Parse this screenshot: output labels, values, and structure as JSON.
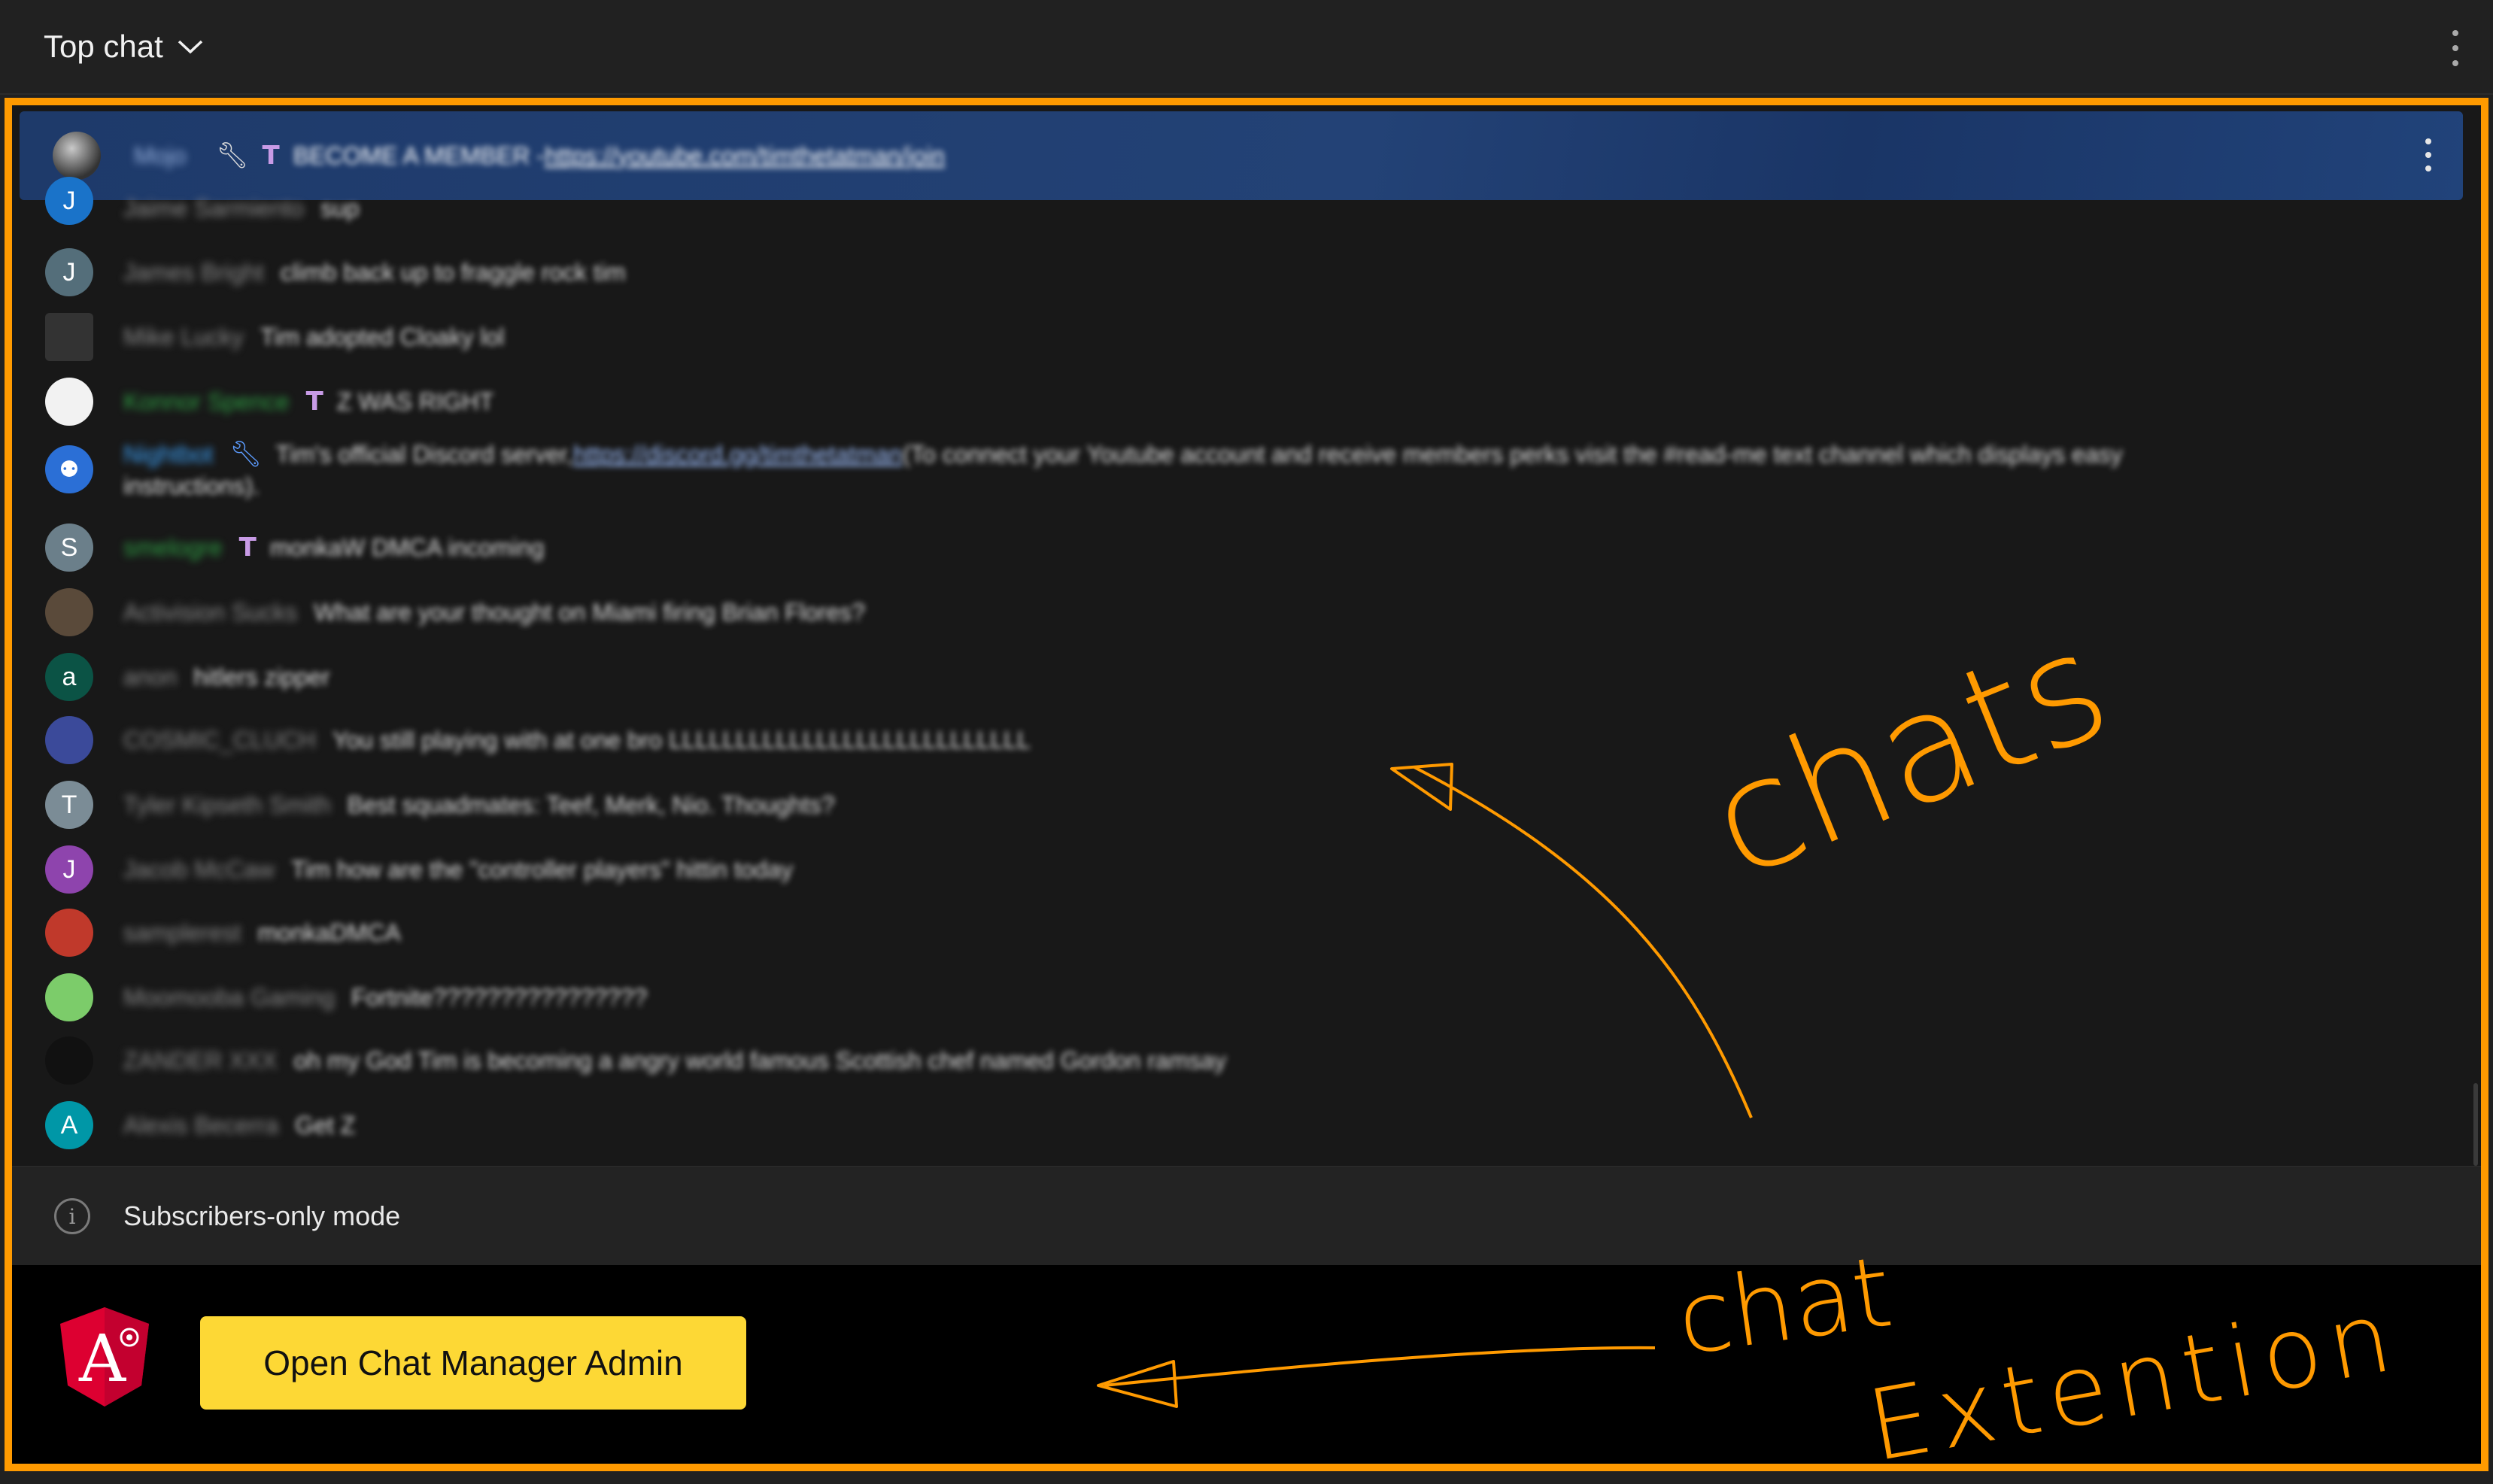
{
  "header": {
    "title": "Top chat",
    "dropdown_icon": "chevron-down-icon",
    "menu_icon": "more-vert-icon"
  },
  "pinned": {
    "author": "Mojo",
    "message": "BECOME A MEMBER - ",
    "link": "https://youtube.com/timthetatman/join"
  },
  "messages": [
    {
      "author": "Jaime Sarmiento",
      "avatar": "J",
      "color": "#1a73c9",
      "message": "sup"
    },
    {
      "author": "James Bright",
      "avatar": "J",
      "color": "#546e7a",
      "message": "climb back up to fraggle rock tim"
    },
    {
      "author": "Mike Lucky",
      "avatar": "",
      "color": "#333333",
      "message": "Tim adopted Cloaky lol"
    },
    {
      "author": "Konnor Spence",
      "avatar": "",
      "color": "#f2f2f2",
      "message": "Z WAS RIGHT"
    },
    {
      "author": "Nightbot",
      "avatar": "",
      "color": "#2b6fd6",
      "message": "Tim's official Discord server, ",
      "link": "https://discord.gg/timthetatman",
      "message2": " (To connect your Youtube account and receive members perks visit the #read-me text channel which displays easy",
      "message3": "instructions)."
    },
    {
      "author": "smelogre",
      "avatar": "S",
      "color": "#6b7f8a",
      "message": "monkaW DMCA incoming"
    },
    {
      "author": "Activision Sucks",
      "avatar": "",
      "color": "#5a4a3a",
      "message": "What are your thought on Miami firing Brian Flores?"
    },
    {
      "author": "anon",
      "avatar": "a",
      "color": "#0b5345",
      "message": "hitlers zipper"
    },
    {
      "author": "COSMIC_CLUCH",
      "avatar": "",
      "color": "#3b4a9a",
      "message": "You still playing with at one bro LLLLLLLLLLLLLLLLLLLLLLLLLLL"
    },
    {
      "author": "Tyler Kipseth Smith",
      "avatar": "T",
      "color": "#7b8c96",
      "message": "Best squadmates: Teef, Merk, Nio. Thoughts?"
    },
    {
      "author": "Jacob McCaw",
      "avatar": "J",
      "color": "#8e44ad",
      "message": "Tim how are the \"controller players\" hittin today"
    },
    {
      "author": "samplerest",
      "avatar": "",
      "color": "#c0392b",
      "message": "monkaDMCA"
    },
    {
      "author": "Moomooba Gaming",
      "avatar": "",
      "color": "#7ccc6a",
      "message": "Fortnite????????????????"
    },
    {
      "author": "ZANDER XXX",
      "avatar": "",
      "color": "#111111",
      "message": "oh my God Tim is becoming a angry world famous Scottish chef named Gordon ramsay"
    },
    {
      "author": "Alexis Becerra",
      "avatar": "A",
      "color": "#0097a7",
      "message": "Get Z"
    }
  ],
  "footer": {
    "mode_label": "Subscribers-only mode",
    "info_icon": "info-icon"
  },
  "extension": {
    "button_label": "Open Chat Manager Admin",
    "logo": "angular-logo-icon",
    "button_color": "#fdd835"
  },
  "annotations": {
    "chats": "chats",
    "chat": "chat",
    "extention": "Extention",
    "color": "#ff9a00"
  }
}
